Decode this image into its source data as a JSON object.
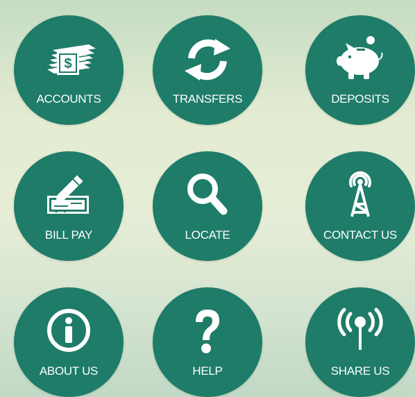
{
  "colors": {
    "tile": "#1e7c68",
    "icon": "#ffffff"
  },
  "menu": {
    "items": [
      {
        "label": "ACCOUNTS",
        "icon": "money-stack-icon"
      },
      {
        "label": "TRANSFERS",
        "icon": "refresh-arrows-icon"
      },
      {
        "label": "DEPOSITS",
        "icon": "piggy-bank-icon"
      },
      {
        "label": "BILL PAY",
        "icon": "check-pencil-icon"
      },
      {
        "label": "LOCATE",
        "icon": "magnifier-icon"
      },
      {
        "label": "CONTACT US",
        "icon": "broadcast-tower-icon"
      },
      {
        "label": "ABOUT US",
        "icon": "info-icon"
      },
      {
        "label": "HELP",
        "icon": "question-mark-icon"
      },
      {
        "label": "SHARE US",
        "icon": "signal-icon"
      }
    ]
  }
}
